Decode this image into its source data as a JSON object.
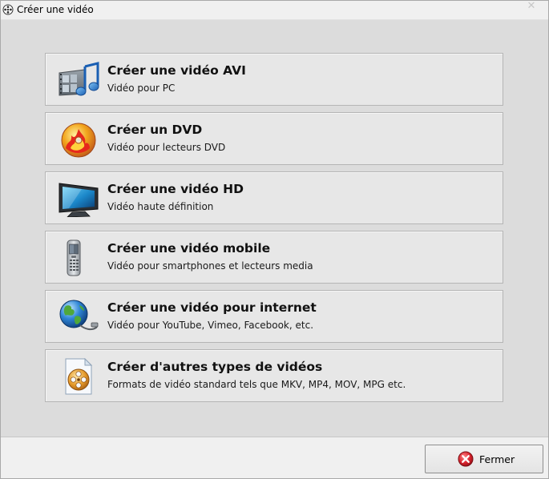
{
  "window": {
    "title": "Créer une vidéo"
  },
  "options": [
    {
      "title": "Créer une vidéo AVI",
      "subtitle": "Vidéo pour PC",
      "icon": "film-music-icon"
    },
    {
      "title": "Créer un DVD",
      "subtitle": "Vidéo pour lecteurs DVD",
      "icon": "dvd-disc-icon"
    },
    {
      "title": "Créer une vidéo HD",
      "subtitle": "Vidéo haute définition",
      "icon": "tv-monitor-icon"
    },
    {
      "title": "Créer une vidéo mobile",
      "subtitle": "Vidéo pour smartphones et lecteurs media",
      "icon": "mobile-phone-icon"
    },
    {
      "title": "Créer une vidéo pour internet",
      "subtitle": "Vidéo pour YouTube, Vimeo, Facebook, etc.",
      "icon": "globe-icon"
    },
    {
      "title": "Créer d'autres types de vidéos",
      "subtitle": "Formats de vidéo standard tels que MKV, MP4, MOV, MPG etc.",
      "icon": "film-reel-file-icon"
    }
  ],
  "footer": {
    "close_label": "Fermer"
  },
  "colors": {
    "background": "#dcdcdc",
    "option_bg": "#e7e7e7",
    "close_icon_red": "#d9232e"
  }
}
